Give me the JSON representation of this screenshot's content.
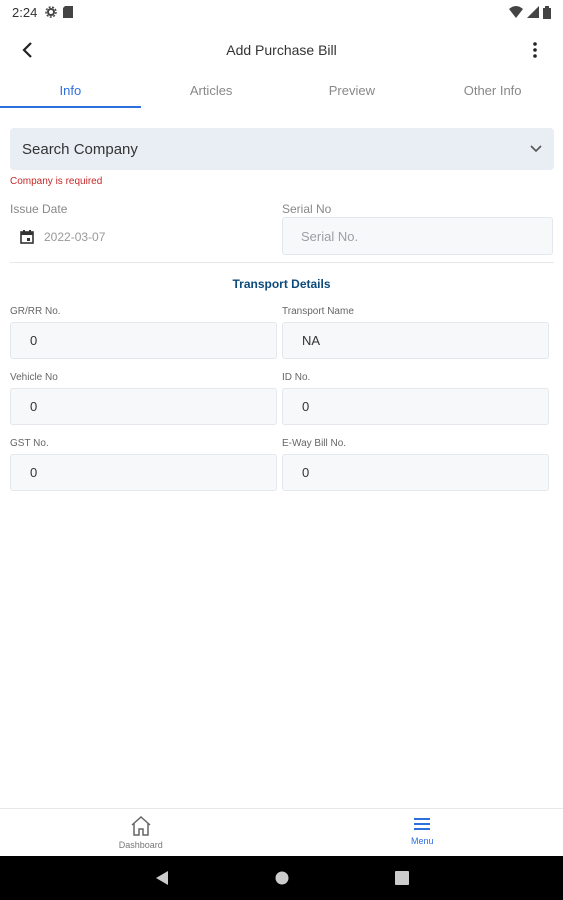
{
  "status_bar": {
    "time": "2:24"
  },
  "app_bar": {
    "title": "Add Purchase Bill"
  },
  "tabs": [
    {
      "label": "Info",
      "active": true
    },
    {
      "label": "Articles",
      "active": false
    },
    {
      "label": "Preview",
      "active": false
    },
    {
      "label": "Other Info",
      "active": false
    }
  ],
  "company": {
    "placeholder": "Search Company",
    "error": "Company is required"
  },
  "issue_date": {
    "label": "Issue Date",
    "value": "2022-03-07"
  },
  "serial": {
    "label": "Serial No",
    "placeholder": "Serial No."
  },
  "transport": {
    "title": "Transport Details",
    "fields": [
      {
        "label": "GR/RR No.",
        "value": "0"
      },
      {
        "label": "Transport Name",
        "value": "NA"
      },
      {
        "label": "Vehicle No",
        "value": "0"
      },
      {
        "label": "ID No.",
        "value": "0"
      },
      {
        "label": "GST No.",
        "value": "0"
      },
      {
        "label": "E-Way Bill No.",
        "value": "0"
      }
    ]
  },
  "bottom_nav": [
    {
      "label": "Dashboard",
      "icon": "home-icon",
      "active": false
    },
    {
      "label": "Menu",
      "icon": "menu-icon",
      "active": true
    }
  ],
  "colors": {
    "accent": "#2e6fe0",
    "error": "#c62828",
    "section_title": "#0b4a7a"
  }
}
